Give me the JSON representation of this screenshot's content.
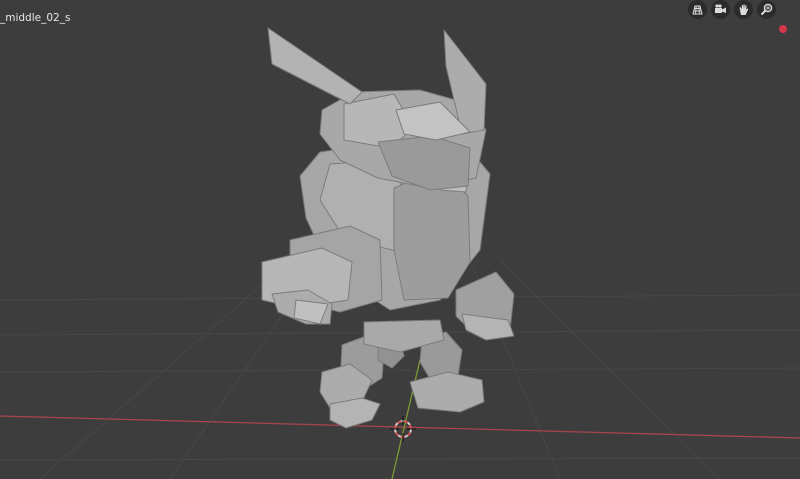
{
  "viewport": {
    "object_name": "_middle_02_s",
    "background_color": "#3d3d3d",
    "grid_color": "#474747",
    "x_axis_color": "#a9454f",
    "y_axis_color": "#7c9a35",
    "model_color": "#a3a3a3"
  },
  "navigation": [
    {
      "name": "toggle-camera-view",
      "icon": "grid-icon"
    },
    {
      "name": "camera-view",
      "icon": "camera-icon"
    },
    {
      "name": "pan-view",
      "icon": "hand-icon"
    },
    {
      "name": "zoom-view",
      "icon": "magnifier-icon"
    }
  ],
  "indicators": {
    "record_color": "#d4384a"
  }
}
